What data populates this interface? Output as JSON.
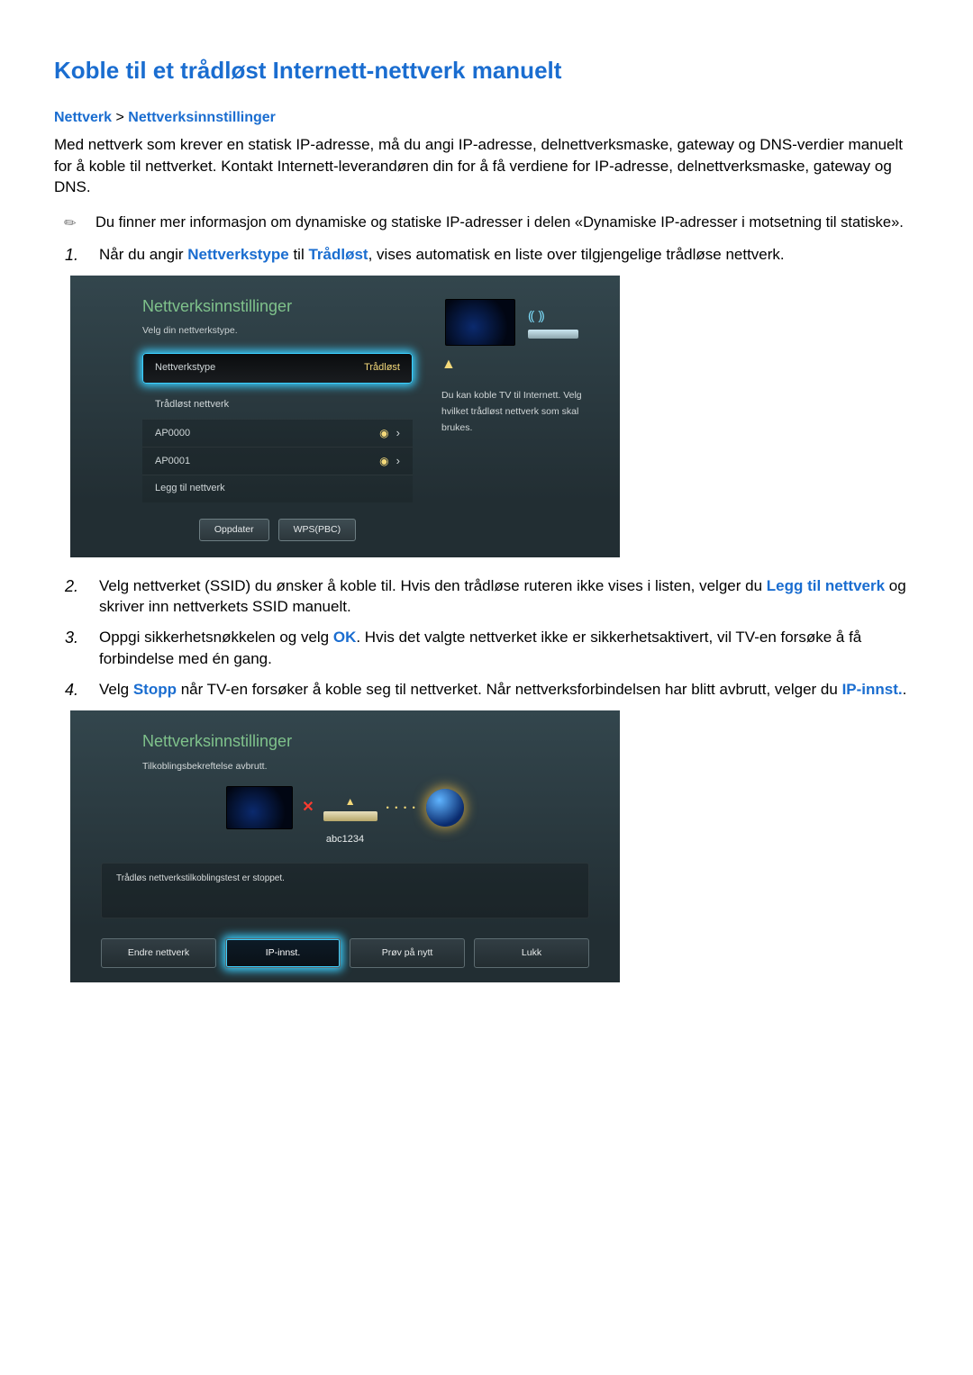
{
  "title": "Koble til et trådløst Internett-nettverk manuelt",
  "breadcrumb": {
    "a": "Nettverk",
    "sep": ">",
    "b": "Nettverksinnstillinger"
  },
  "intro": "Med nettverk som krever en statisk IP-adresse, må du angi IP-adresse, delnettverksmaske, gateway og DNS-verdier manuelt for å koble til nettverket. Kontakt Internett-leverandøren din for å få verdiene for IP-adresse, delnettverksmaske, gateway og DNS.",
  "note": "Du finner mer informasjon om dynamiske og statiske IP-adresser i delen «Dynamiske IP-adresser i motsetning til statiske».",
  "steps": {
    "s1a": "Når du angir ",
    "s1b": "Nettverkstype",
    "s1c": " til ",
    "s1d": "Trådløst",
    "s1e": ", vises automatisk en liste over tilgjengelige trådløse nettverk.",
    "s2a": "Velg nettverket (SSID) du ønsker å koble til. Hvis den trådløse ruteren ikke vises i listen, velger du ",
    "s2b": "Legg til nettverk",
    "s2c": " og skriver inn nettverkets SSID manuelt.",
    "s3a": "Oppgi sikkerhetsnøkkelen og velg ",
    "s3b": "OK",
    "s3c": ". Hvis det valgte nettverket ikke er sikkerhetsaktivert, vil TV-en forsøke å få forbindelse med én gang.",
    "s4a": "Velg ",
    "s4b": "Stopp",
    "s4c": " når TV-en forsøker å koble seg til nettverket. Når nettverksforbindelsen har blitt avbrutt, velger du ",
    "s4d": "IP-innst.",
    "s4e": "."
  },
  "ui1": {
    "title": "Nettverksinnstillinger",
    "sub": "Velg din nettverkstype.",
    "field_label": "Nettverkstype",
    "field_value": "Trådløst",
    "section": "Trådløst nettverk",
    "ap0": "AP0000",
    "ap1": "AP0001",
    "add": "Legg til nettverk",
    "btn_refresh": "Oppdater",
    "btn_wps": "WPS(PBC)",
    "help": "Du kan koble TV til Internett. Velg hvilket trådløst nettverk som skal brukes."
  },
  "ui2": {
    "title": "Nettverksinnstillinger",
    "sub": "Tilkoblingsbekreftelse avbrutt.",
    "ssid": "abc1234",
    "msg": "Trådløs nettverkstilkoblingstest er stoppet.",
    "b1": "Endre nettverk",
    "b2": "IP-innst.",
    "b3": "Prøv på nytt",
    "b4": "Lukk"
  }
}
